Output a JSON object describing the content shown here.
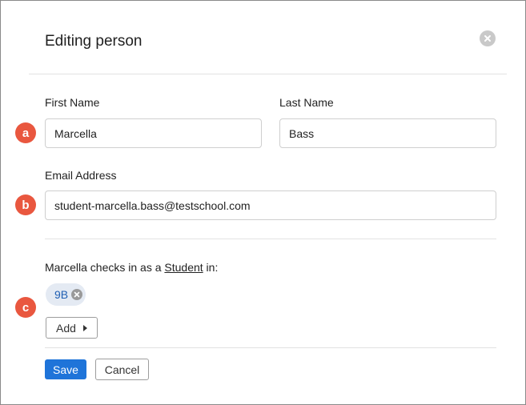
{
  "dialog": {
    "title": "Editing person",
    "close_icon": "close-circle-icon"
  },
  "fields": {
    "first_name": {
      "label": "First Name",
      "value": "Marcella"
    },
    "last_name": {
      "label": "Last Name",
      "value": "Bass"
    },
    "email": {
      "label": "Email Address",
      "value": "student-marcella.bass@testschool.com"
    }
  },
  "checkin": {
    "prefix": "Marcella checks in as a ",
    "role": "Student",
    "suffix": " in:",
    "groups": [
      {
        "label": "9B"
      }
    ],
    "add_label": "Add"
  },
  "markers": {
    "a": "a",
    "b": "b",
    "c": "c"
  },
  "actions": {
    "save_label": "Save",
    "cancel_label": "Cancel"
  },
  "colors": {
    "accent": "#1f74d9",
    "marker": "#e9573f",
    "tag_bg": "#e4eaf3",
    "tag_text": "#1f5fb3"
  }
}
